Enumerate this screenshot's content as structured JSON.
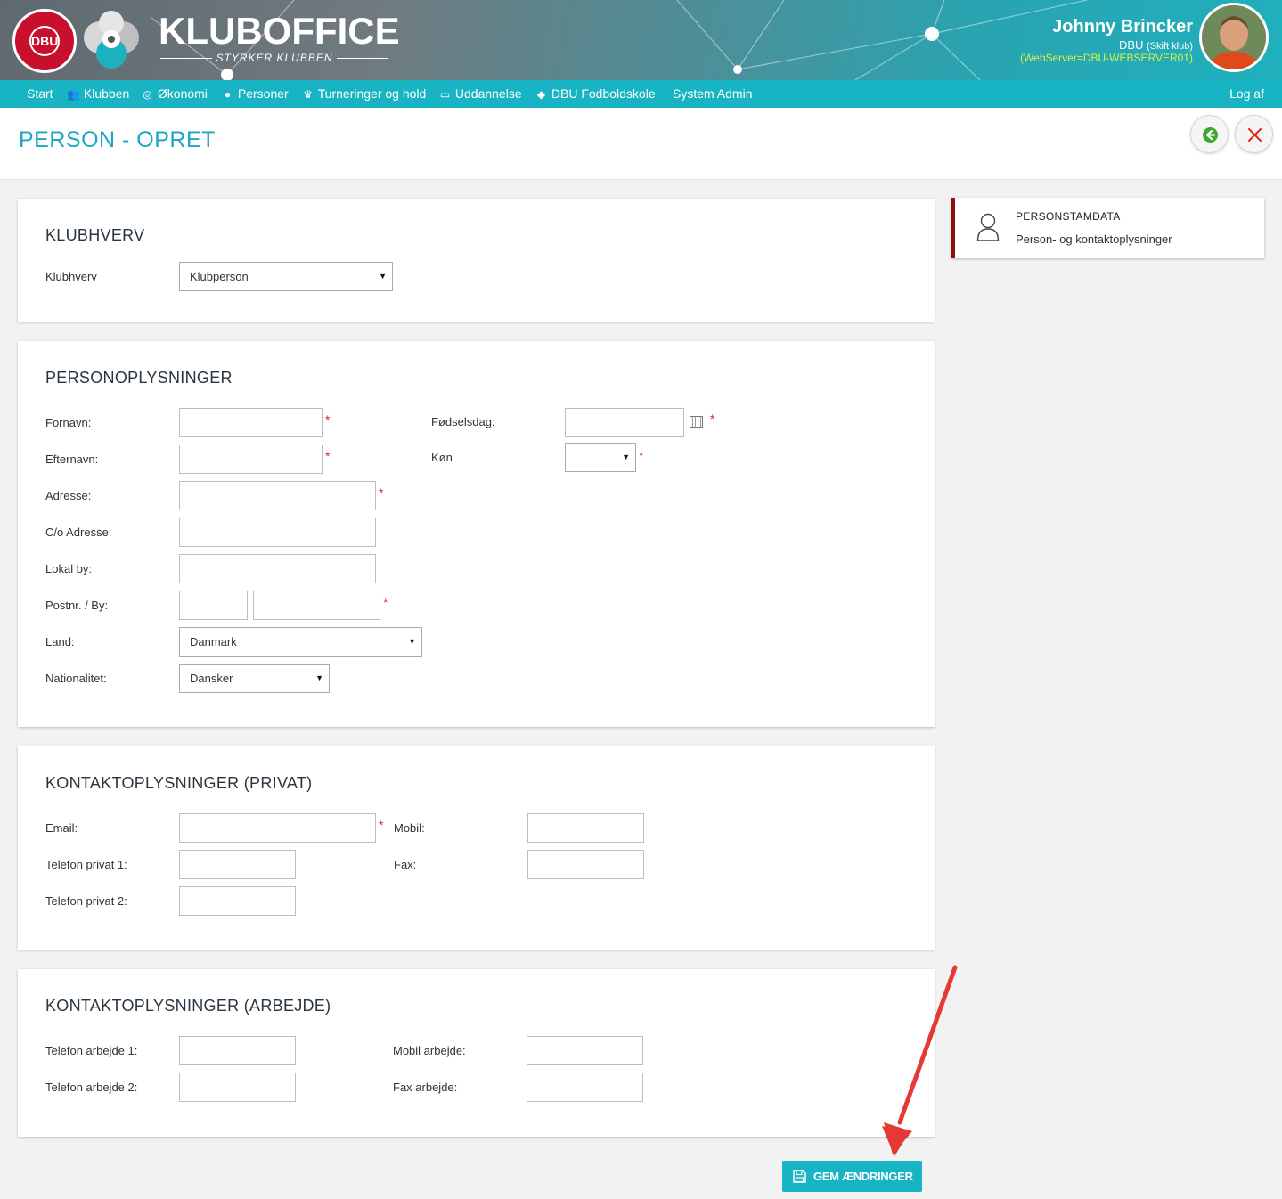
{
  "header": {
    "app_name": "KLUBOFFICE",
    "tagline": "STYRKER KLUBBEN",
    "logo_text": "DBU",
    "user_name": "Johnny Brincker",
    "user_club": "DBU",
    "switch_club": "(Skift klub)",
    "server": "(WebServer=DBU-WEBSERVER01)"
  },
  "nav": {
    "items": [
      {
        "label": "Start",
        "icon": "none"
      },
      {
        "label": "Klubben",
        "icon": "people-icon"
      },
      {
        "label": "Økonomi",
        "icon": "coin-icon"
      },
      {
        "label": "Personer",
        "icon": "person-icon"
      },
      {
        "label": "Turneringer og hold",
        "icon": "trophy-icon"
      },
      {
        "label": "Uddannelse",
        "icon": "presentation-icon"
      },
      {
        "label": "DBU Fodboldskole",
        "icon": "graduation-cap-icon"
      },
      {
        "label": "System Admin",
        "icon": "none"
      }
    ],
    "logout": "Log af"
  },
  "page": {
    "title": "PERSON - OPRET"
  },
  "klubhverv": {
    "heading": "KLUBHVERV",
    "label": "Klubhverv",
    "value": "Klubperson"
  },
  "person": {
    "heading": "PERSONOPLYSNINGER",
    "fornavn": "Fornavn:",
    "efternavn": "Efternavn:",
    "adresse": "Adresse:",
    "co_adresse": "C/o Adresse:",
    "lokal_by": "Lokal by:",
    "postnr_by": "Postnr. / By:",
    "land": "Land:",
    "land_value": "Danmark",
    "nationalitet": "Nationalitet:",
    "nationalitet_value": "Dansker",
    "foedselsdag": "Fødselsdag:",
    "koen": "Køn",
    "koen_value": ""
  },
  "privat": {
    "heading": "KONTAKTOPLYSNINGER (PRIVAT)",
    "email": "Email:",
    "telefon1": "Telefon privat 1:",
    "telefon2": "Telefon privat 2:",
    "mobil": "Mobil:",
    "fax": "Fax:"
  },
  "arbejde": {
    "heading": "KONTAKTOPLYSNINGER (ARBEJDE)",
    "telefon1": "Telefon arbejde 1:",
    "telefon2": "Telefon arbejde 2:",
    "mobil": "Mobil arbejde:",
    "fax": "Fax arbejde:"
  },
  "side_card": {
    "title": "PERSONSTAMDATA",
    "subtitle": "Person- og kontaktoplysninger"
  },
  "required_mark": "*",
  "save_label": "GEM ÆNDRINGER",
  "colors": {
    "accent": "#18b4c4",
    "title": "#1fa5c4",
    "required": "#e02020",
    "card_border": "#8b1010",
    "annotation_arrow": "#e53935"
  }
}
